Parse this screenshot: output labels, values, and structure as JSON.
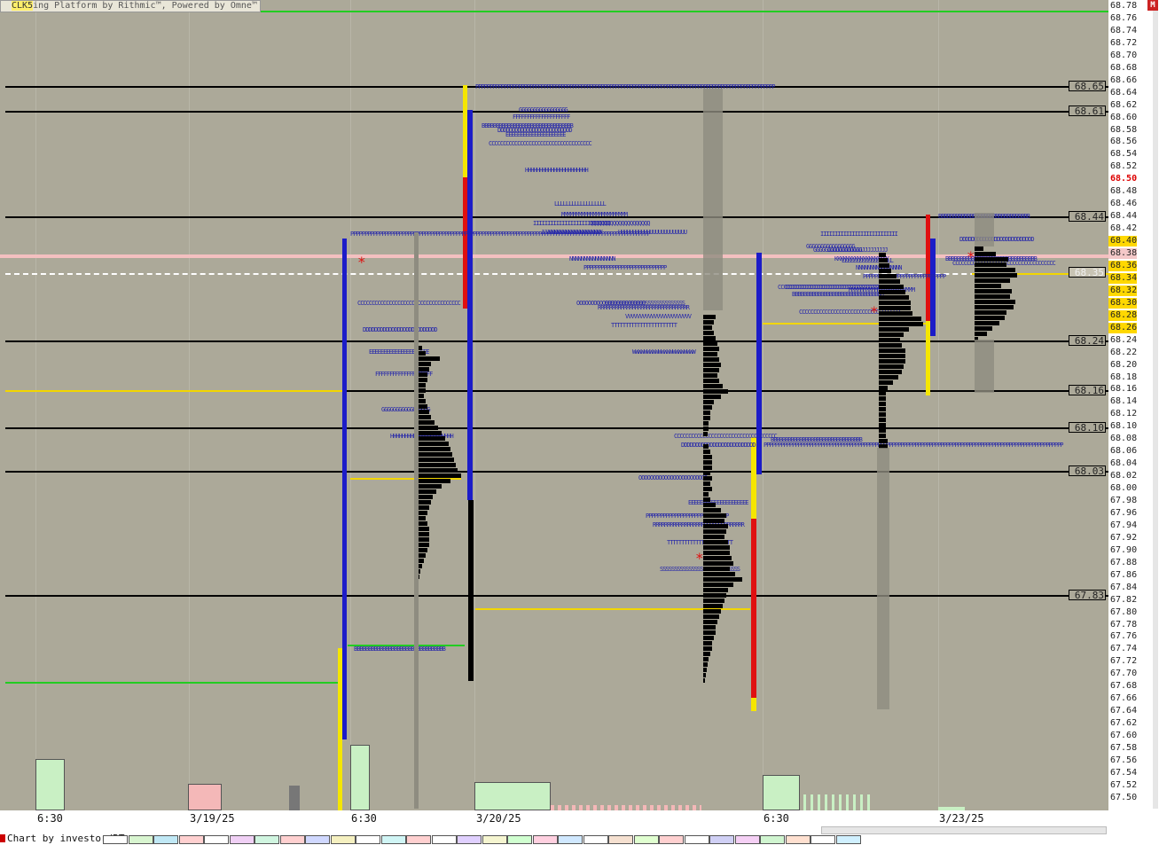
{
  "window": {
    "title_symbol": "CLK5",
    "title_text": "ing Platform by Rithmic™, Powered by Omne™",
    "info_icon": "i",
    "menu_button": "M"
  },
  "price_scale": {
    "ticks": [
      "68.78",
      "68.76",
      "68.74",
      "68.72",
      "68.70",
      "68.68",
      "68.66",
      "68.64",
      "68.62",
      "68.60",
      "68.58",
      "68.56",
      "68.54",
      "68.52",
      "68.50",
      "68.48",
      "68.46",
      "68.44",
      "68.42",
      "68.40",
      "68.38",
      "68.36",
      "68.34",
      "68.32",
      "68.30",
      "68.28",
      "68.26",
      "68.24",
      "68.22",
      "68.20",
      "68.18",
      "68.16",
      "68.14",
      "68.12",
      "68.10",
      "68.08",
      "68.06",
      "68.04",
      "68.02",
      "68.00",
      "67.98",
      "67.96",
      "67.94",
      "67.92",
      "67.90",
      "67.88",
      "67.86",
      "67.84",
      "67.82",
      "67.80",
      "67.78",
      "67.76",
      "67.74",
      "67.72",
      "67.70",
      "67.68",
      "67.66",
      "67.64",
      "67.62",
      "67.60",
      "67.58",
      "67.56",
      "67.54",
      "67.52",
      "67.50"
    ],
    "current_price": "68.50",
    "highlighted": [
      "68.40",
      "68.36",
      "68.34",
      "68.32",
      "68.30",
      "68.28",
      "68.26"
    ],
    "pink": [
      "68.38"
    ]
  },
  "level_labels": [
    "68.65",
    "68.61",
    "68.44",
    "68.35",
    "68.24",
    "68.16",
    "68.10",
    "68.03",
    "67.83"
  ],
  "x_axis": {
    "labels": [
      "6:30",
      "3/19/25",
      "6:30",
      "3/20/25",
      "6:30",
      "3/23/25"
    ]
  },
  "tpo_columns": {
    "col1": "PPPPPPPPPPPPPPPPPPPPPPPPPPPPPPPPPPPPPPPPPPPPPPPPPPPPPPPPPPPPPPPPPPPPPPPPPPPPPPPPPPPPPPPPPPPPPPPPPPPPPPPPP",
    "col_b": "BBBBBBBBBBBBBBBBBBBBBBBBBBBBBBBB",
    "col_c": "CCCCCCCCCCCCCCCCCCCCCCCCCCCCCCCCCCCC",
    "col_d": "DDDDDDDDDDDDDDDDDDDDDDDDDD",
    "col_e": "EEEEEEEEEEEEEEEEEEEEE",
    "col_f": "FFFFFFFFFFFFFFFFFFFF",
    "col_g": "GGGGGGGGGGGGGGGGG",
    "col_h": "HHHHHHHHHHHHHHHHHHHHHH",
    "col_i": "IIIIIIIIIIIIIIIIIIIIIIIIIII",
    "col_j": "JJJJJJJJJJJJJJJJJJJJJ",
    "col_k": "KKKKKKKKKKKKKKKKKKK",
    "col_l": "LLLLLLLLLLLLLLLLLL",
    "col_m": "MMMMMMMMMMMMMMMMMMMMMMM",
    "col_n": "NNNNNNNNNNNNNNNN",
    "col_o": "OOOOOOOOOOOOOOOOOOOOOOOO",
    "col_p": "PPPPPPPPPPPPPPPPPPPPPPPPPPPPP",
    "col_q": "QQQQQQQQQQQQQQQQQQQQQ",
    "col_r": "RRRRRRRRRRRRRRRRRRRRRRRRRRRRRRRR",
    "col_s": "SSSSSSSSSSSSSSSSSSSSSSSSSSSS",
    "col_t": "TTTTTTTTTTTTTTTTTTTTTTT",
    "col_u": "UUUUUUUUUUUUUUUUUUUUUUUU",
    "col_v": "VVVVVVVVVVVVVVVVVVVVVVV",
    "col_w": "WWWWWWWWWWWWWWWWWWWWWW"
  },
  "footer": {
    "credit": "Chart by investor/RT"
  },
  "colors": {
    "plot_bg": "#aca999",
    "blue_range": "#1c1cc8",
    "yellow_range": "#f5e600",
    "red_range": "#e01010",
    "black_line": "#000000",
    "poc_yellow": "#f2d600",
    "green_line": "#22cc22"
  }
}
